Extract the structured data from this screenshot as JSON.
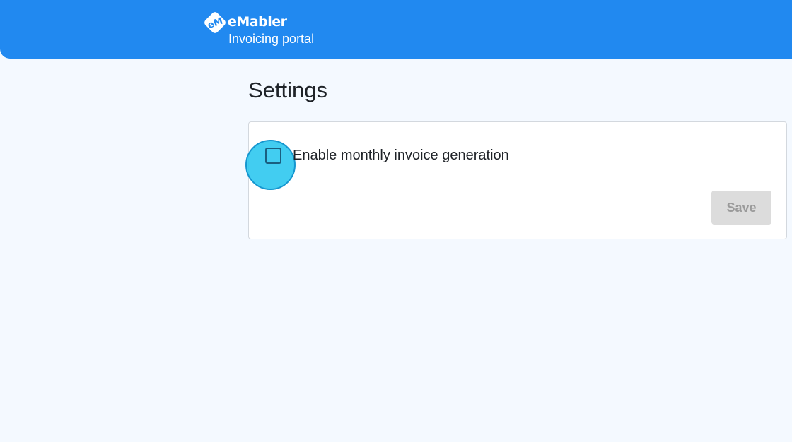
{
  "header": {
    "brand_name": "eMabler",
    "subtitle": "Invoicing portal",
    "logo_icon": "emabler-logo-icon",
    "background_color": "#2189f0"
  },
  "page": {
    "title": "Settings",
    "background_color": "#f4f9ff"
  },
  "settings_card": {
    "checkbox": {
      "label": "Enable monthly invoice generation",
      "checked": false
    },
    "save_button": {
      "label": "Save",
      "disabled": true
    }
  }
}
